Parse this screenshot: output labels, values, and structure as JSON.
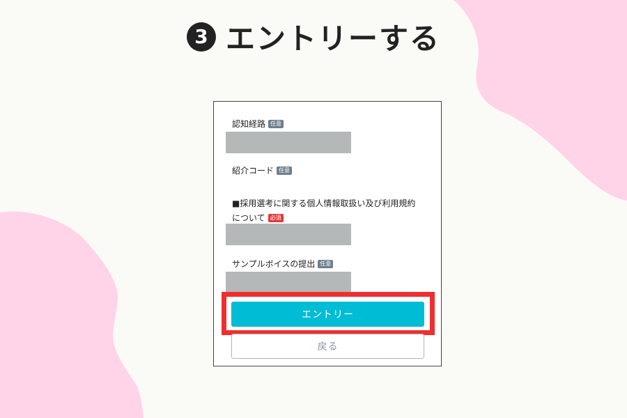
{
  "heading": {
    "step_number": "3",
    "title": "エントリーする"
  },
  "form": {
    "fields": [
      {
        "label": "認知経路",
        "badge": "任意"
      },
      {
        "label": "紹介コード",
        "badge": "任意"
      },
      {
        "label_line1": "■採用選考に関する個人情報取扱い及び利用規約",
        "label_line2": "について",
        "badge": "必須"
      },
      {
        "label": "サンプルボイスの提出",
        "badge": "任意"
      }
    ],
    "entry_button": "エントリー",
    "back_button": "戻る"
  },
  "colors": {
    "page_background": "#fafaf7",
    "decor_blob": "#ffd3e8",
    "optional_badge": "#6d7f8c",
    "required_badge": "#e6393a",
    "entry_button": "#00bcd4",
    "highlight_frame": "#ef2f2f",
    "field_placeholder": "#b4b8b8"
  }
}
